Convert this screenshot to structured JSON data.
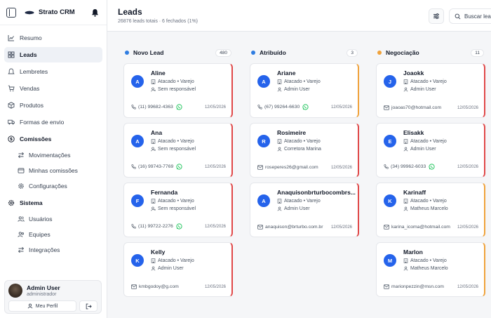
{
  "app": {
    "brand": "Strato CRM"
  },
  "nav": {
    "resumo": "Resumo",
    "leads": "Leads",
    "lembretes": "Lembretes",
    "vendas": "Vendas",
    "produtos": "Produtos",
    "formas_envio": "Formas de envio",
    "comissoes": "Comissões",
    "movimentacoes": "Movimentações",
    "minhas_comissoes": "Minhas comissões",
    "configuracoes": "Configurações",
    "sistema": "Sistema",
    "usuarios": "Usuários",
    "equipes": "Equipes",
    "integracoes": "Integrações"
  },
  "user": {
    "name": "Admin User",
    "role": "administrador",
    "profile_label": "Meu Perfil"
  },
  "header": {
    "title": "Leads",
    "subtitle": "26876 leads totais · 6 fechados (1%)",
    "search_label": "Buscar leads"
  },
  "columns": [
    {
      "title": "Novo Lead",
      "count": "480",
      "dot_color": "#2f7de1",
      "cards": [
        {
          "initial": "A",
          "name": "Aline",
          "segment": "Atacado • Varejo",
          "owner": "Sem responsável",
          "contact": "(11) 99682-4363",
          "contact_type": "phone",
          "whatsapp": true,
          "date": "12/05/2026",
          "accent": "red"
        },
        {
          "initial": "A",
          "name": "Ana",
          "segment": "Atacado • Varejo",
          "owner": "Sem responsável",
          "contact": "(16) 99743-7769",
          "contact_type": "phone",
          "whatsapp": true,
          "date": "12/05/2026",
          "accent": "red"
        },
        {
          "initial": "F",
          "name": "Fernanda",
          "segment": "Atacado • Varejo",
          "owner": "Sem responsável",
          "contact": "(11) 99722-2276",
          "contact_type": "phone",
          "whatsapp": true,
          "date": "12/05/2026",
          "accent": "red"
        },
        {
          "initial": "K",
          "name": "Kelly",
          "segment": "Atacado • Varejo",
          "owner": "Admin User",
          "contact": "kmbgodoy@g.com",
          "contact_type": "email",
          "whatsapp": false,
          "date": "12/05/2026",
          "accent": "red"
        }
      ]
    },
    {
      "title": "Atribuído",
      "count": "3",
      "dot_color": "#2f7de1",
      "cards": [
        {
          "initial": "A",
          "name": "Ariane",
          "segment": "Atacado • Varejo",
          "owner": "Admin User",
          "contact": "(67) 99264-6630",
          "contact_type": "phone",
          "whatsapp": true,
          "date": "12/05/2026",
          "accent": "orange"
        },
        {
          "initial": "R",
          "name": "Rosimeire",
          "segment": "Atacado • Varejo",
          "owner": "Corretora Marina",
          "contact": "roseperes26@gmail.com",
          "contact_type": "email",
          "whatsapp": false,
          "date": "12/05/2026",
          "accent": "red"
        },
        {
          "initial": "A",
          "name": "Anaquisonbrturbocombrs...",
          "segment": "Atacado • Varejo",
          "owner": "Admin User",
          "contact": "anaquison@brturbo.com.br",
          "contact_type": "email",
          "whatsapp": false,
          "date": "12/05/2026",
          "accent": "red"
        }
      ]
    },
    {
      "title": "Negociação",
      "count": "11",
      "dot_color": "#f0a23a",
      "cards": [
        {
          "initial": "J",
          "name": "Joaokk",
          "segment": "Atacado • Varejo",
          "owner": "Admin User",
          "contact": "joaoas70@hotmail.com",
          "contact_type": "email",
          "whatsapp": false,
          "date": "12/05/2026",
          "accent": "red"
        },
        {
          "initial": "E",
          "name": "Elisakk",
          "segment": "Atacado • Varejo",
          "owner": "Admin User",
          "contact": "(34) 99962-6033",
          "contact_type": "phone",
          "whatsapp": true,
          "date": "12/05/2026",
          "accent": "red"
        },
        {
          "initial": "K",
          "name": "Karinaff",
          "segment": "Atacado • Varejo",
          "owner": "Matheus Marcelo",
          "contact": "karina_icoma@hotmail.com",
          "contact_type": "email",
          "whatsapp": false,
          "date": "12/05/2026",
          "accent": "orange"
        },
        {
          "initial": "M",
          "name": "Marlon",
          "segment": "Atacado • Varejo",
          "owner": "Matheus Marcelo",
          "contact": "marionpezzin@msn.com",
          "contact_type": "email",
          "whatsapp": false,
          "date": "12/05/2026",
          "accent": "orange"
        }
      ]
    }
  ]
}
